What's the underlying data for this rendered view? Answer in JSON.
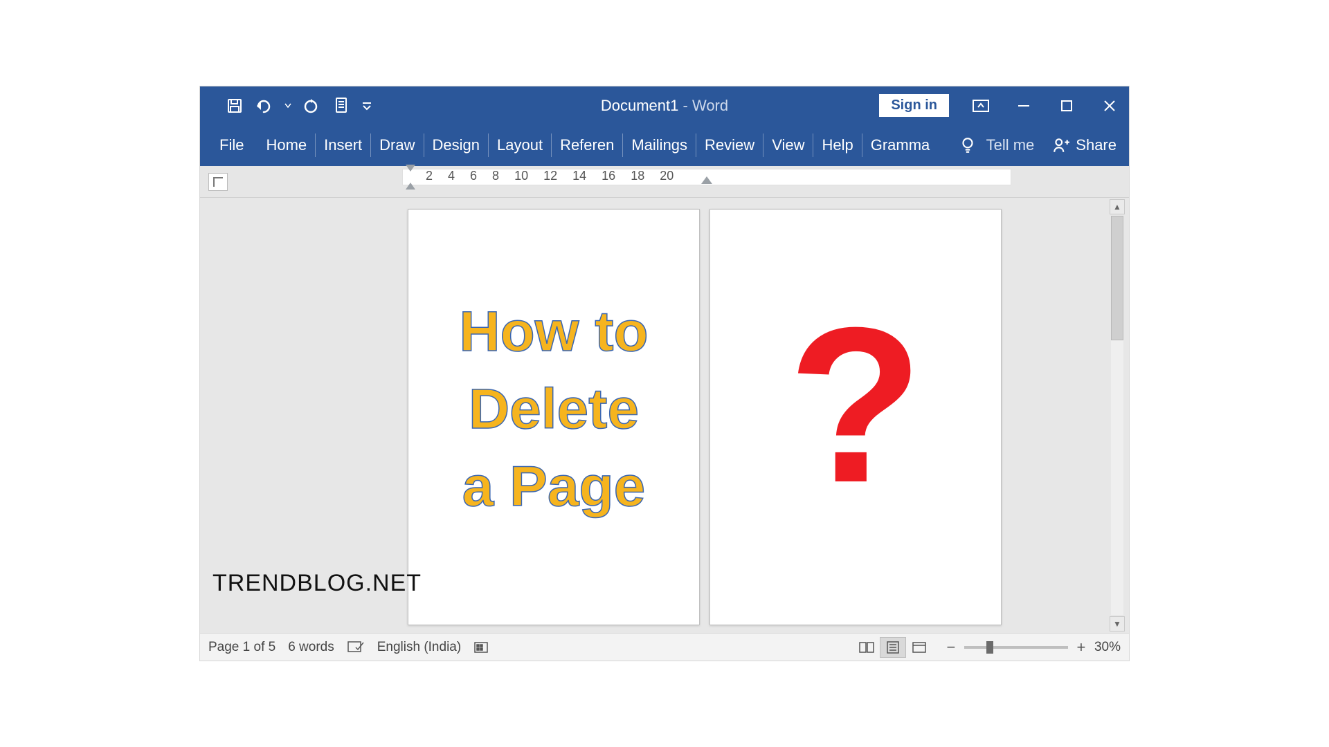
{
  "title": {
    "doc": "Document1",
    "sep": "  -  ",
    "app": "Word"
  },
  "qat": {
    "save": "save-icon",
    "undo": "undo-icon",
    "redo": "redo-icon",
    "touch": "touch-mode-icon",
    "customize": "customize-qat-icon"
  },
  "signin_label": "Sign in",
  "ribbon": {
    "file": "File",
    "tabs": [
      "Home",
      "Insert",
      "Draw",
      "Design",
      "Layout",
      "Referen",
      "Mailings",
      "Review",
      "View",
      "Help",
      "Gramma"
    ],
    "tellme": "Tell me",
    "share": "Share"
  },
  "ruler": {
    "labels": [
      "2",
      "4",
      "6",
      "8",
      "10",
      "12",
      "14",
      "16",
      "18",
      "20"
    ]
  },
  "document": {
    "page1": {
      "line1": "How to",
      "line2": "Delete",
      "line3": "a Page"
    },
    "page2": {
      "glyph": "?"
    }
  },
  "statusbar": {
    "page": "Page 1 of 5",
    "words": "6 words",
    "language": "English (India)",
    "zoom_pct": "30%"
  },
  "watermark": "TRENDBLOG.NET"
}
